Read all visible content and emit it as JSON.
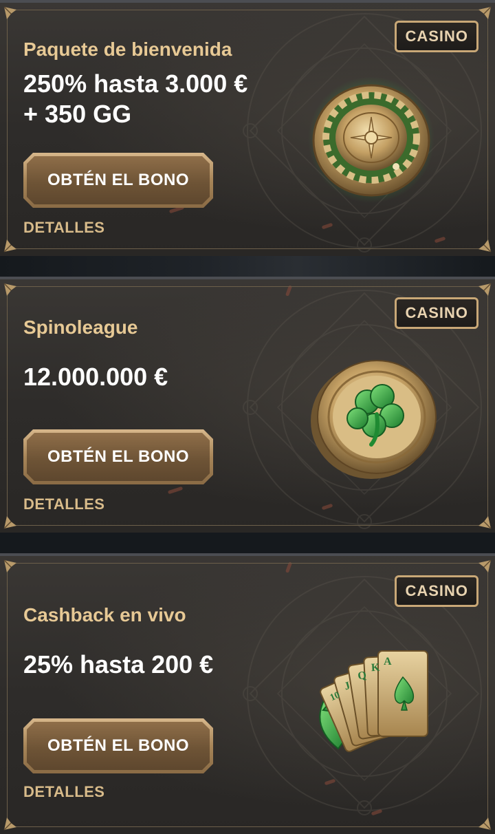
{
  "promos": [
    {
      "badge": "CASINO",
      "subtitle": "Paquete de bienvenida",
      "offer_line1": "250% hasta 3.000 €",
      "offer_line2": "+ 350 GG",
      "button_label": "OBTÉN EL BONO",
      "details_label": "DETALLES",
      "art_icon": "roulette-wheel-icon"
    },
    {
      "badge": "CASINO",
      "subtitle": "Spinoleague",
      "offer_line1": "12.000.000 €",
      "button_label": "OBTÉN EL BONO",
      "details_label": "DETALLES",
      "art_icon": "clover-coin-icon"
    },
    {
      "badge": "CASINO",
      "subtitle": "Cashback en vivo",
      "offer_line1": "25% hasta 200 €",
      "button_label": "OBTÉN EL BONO",
      "details_label": "DETALLES",
      "art_icon": "playing-cards-icon",
      "card_letters": [
        "10",
        "J",
        "Q",
        "K",
        "A"
      ]
    }
  ],
  "colors": {
    "accent_gold": "#e7c995",
    "button_gold": "#a78558",
    "card_bg": "#2e2c2a",
    "emerald": "#2fa043"
  }
}
